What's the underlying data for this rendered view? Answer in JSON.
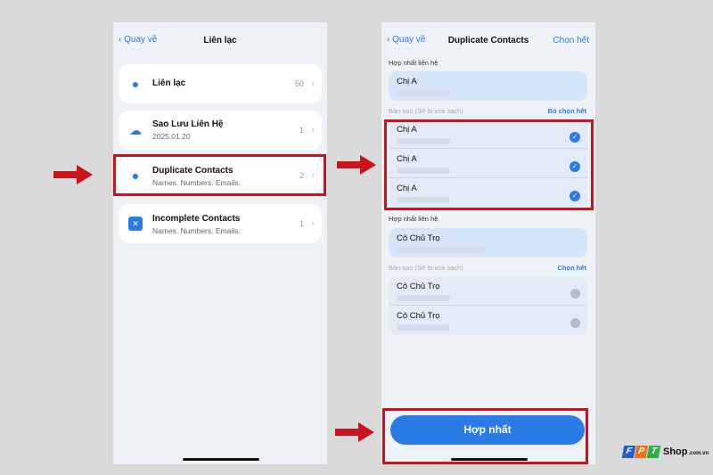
{
  "screen1": {
    "back": "Quay về",
    "title": "Liên lạc",
    "items": [
      {
        "title": "Liên lạc",
        "subtitle": "",
        "count": "50",
        "icon": "person-icon"
      },
      {
        "title": "Sao Lưu Liên Hệ",
        "subtitle": "2025.01.20",
        "count": "1",
        "icon": "cloud-upload-icon"
      },
      {
        "title": "Duplicate Contacts",
        "subtitle": "Names. Numbers. Emails.",
        "count": "2",
        "icon": "duplicate-person-icon"
      },
      {
        "title": "Incomplete Contacts",
        "subtitle": "Names. Numbers. Emails.",
        "count": "1",
        "icon": "x-square-icon"
      }
    ]
  },
  "screen2": {
    "back": "Quay về",
    "title": "Duplicate Contacts",
    "select_all": "Chọn hết",
    "groups": [
      {
        "label": "Hợp nhất liên hệ",
        "merged": "Chị A",
        "copies_label": "Bản sao (Sẽ bị xóa sạch)",
        "action": "Bỏ chọn hết",
        "copies": [
          {
            "name": "Chị A",
            "checked": true
          },
          {
            "name": "Chị A",
            "checked": true
          },
          {
            "name": "Chị A",
            "checked": true
          }
        ]
      },
      {
        "label": "Hợp nhất liên hệ",
        "merged": "Cô Chủ Trọ",
        "copies_label": "Bản sao (Sẽ bị xóa sạch)",
        "action": "Chọn hết",
        "copies": [
          {
            "name": "Cô Chủ Trọ",
            "checked": false
          },
          {
            "name": "Cô Chủ Trọ",
            "checked": false
          }
        ]
      }
    ],
    "merge_button": "Hợp nhất"
  },
  "logo": {
    "letters": [
      "F",
      "P",
      "T"
    ],
    "text": "Shop",
    "suffix": ".com.vn"
  },
  "colors": {
    "accent": "#2b7be6",
    "highlight": "#c9141c"
  }
}
